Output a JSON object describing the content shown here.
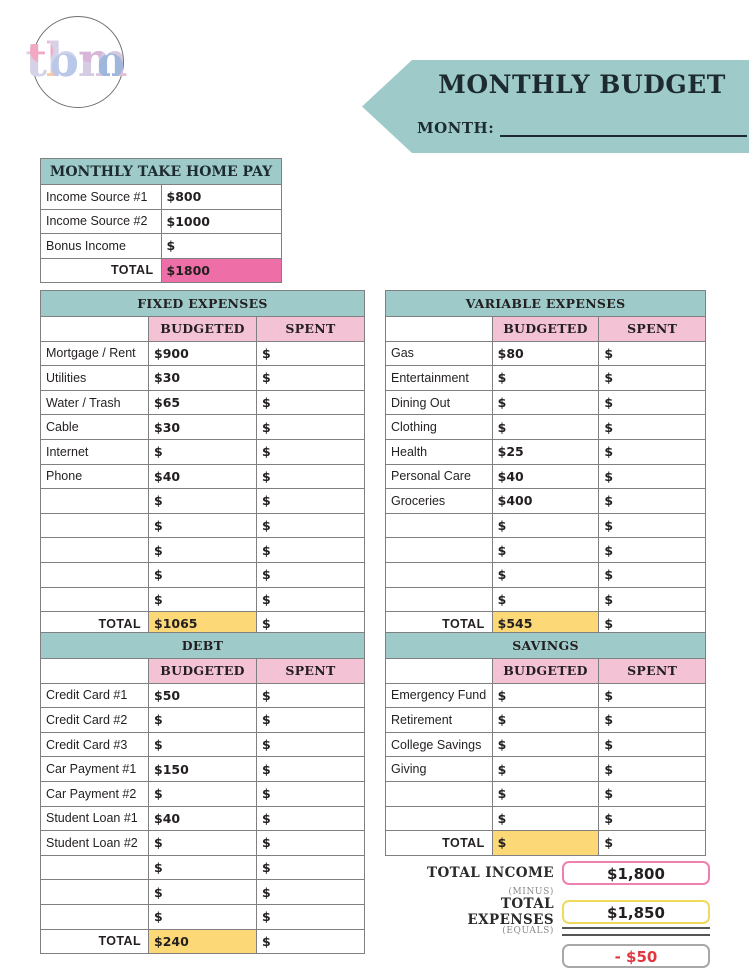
{
  "logo": {
    "text": "tbm"
  },
  "banner": {
    "title": "MONTHLY BUDGET",
    "month_label": "MONTH:",
    "month_value": "",
    "color": "#9ecbc9"
  },
  "colors": {
    "header_teal": "#9ecbc9",
    "column_pink": "#f3c2d4",
    "total_yellow": "#fcd976",
    "income_total_pink": "#ee6fa8",
    "negative_red": "#e0383e"
  },
  "income": {
    "title": "MONTHLY TAKE HOME PAY",
    "rows": [
      {
        "label": "Income Source #1",
        "value": "$800"
      },
      {
        "label": "Income Source #2",
        "value": "$1000"
      },
      {
        "label": "Bonus Income",
        "value": "$"
      }
    ],
    "total_label": "TOTAL",
    "total_value": "$1800"
  },
  "columns": {
    "budgeted": "BUDGETED",
    "spent": "SPENT"
  },
  "total_label": "TOTAL",
  "blank_money": "$",
  "sections": [
    {
      "title": "FIXED EXPENSES",
      "rows": [
        {
          "label": "Mortgage / Rent",
          "budgeted": "$900",
          "spent": "$"
        },
        {
          "label": "Utilities",
          "budgeted": "$30",
          "spent": "$"
        },
        {
          "label": "Water / Trash",
          "budgeted": "$65",
          "spent": "$"
        },
        {
          "label": "Cable",
          "budgeted": "$30",
          "spent": "$"
        },
        {
          "label": "Internet",
          "budgeted": "$",
          "spent": "$"
        },
        {
          "label": "Phone",
          "budgeted": "$40",
          "spent": "$"
        },
        {
          "label": "",
          "budgeted": "$",
          "spent": "$"
        },
        {
          "label": "",
          "budgeted": "$",
          "spent": "$"
        },
        {
          "label": "",
          "budgeted": "$",
          "spent": "$"
        },
        {
          "label": "",
          "budgeted": "$",
          "spent": "$"
        },
        {
          "label": "",
          "budgeted": "$",
          "spent": "$"
        }
      ],
      "total_budgeted": "$1065",
      "total_spent": "$"
    },
    {
      "title": "VARIABLE EXPENSES",
      "rows": [
        {
          "label": "Gas",
          "budgeted": "$80",
          "spent": "$"
        },
        {
          "label": "Entertainment",
          "budgeted": "$",
          "spent": "$"
        },
        {
          "label": "Dining Out",
          "budgeted": "$",
          "spent": "$"
        },
        {
          "label": "Clothing",
          "budgeted": "$",
          "spent": "$"
        },
        {
          "label": "Health",
          "budgeted": "$25",
          "spent": "$"
        },
        {
          "label": "Personal Care",
          "budgeted": "$40",
          "spent": "$"
        },
        {
          "label": "Groceries",
          "budgeted": "$400",
          "spent": "$"
        },
        {
          "label": "",
          "budgeted": "$",
          "spent": "$"
        },
        {
          "label": "",
          "budgeted": "$",
          "spent": "$"
        },
        {
          "label": "",
          "budgeted": "$",
          "spent": "$"
        },
        {
          "label": "",
          "budgeted": "$",
          "spent": "$"
        }
      ],
      "total_budgeted": "$545",
      "total_spent": "$"
    },
    {
      "title": "DEBT",
      "rows": [
        {
          "label": "Credit Card #1",
          "budgeted": "$50",
          "spent": "$"
        },
        {
          "label": "Credit Card #2",
          "budgeted": "$",
          "spent": "$"
        },
        {
          "label": "Credit Card #3",
          "budgeted": "$",
          "spent": "$"
        },
        {
          "label": "Car Payment #1",
          "budgeted": "$150",
          "spent": "$"
        },
        {
          "label": "Car Payment #2",
          "budgeted": "$",
          "spent": "$"
        },
        {
          "label": "Student Loan #1",
          "budgeted": "$40",
          "spent": "$"
        },
        {
          "label": "Student Loan #2",
          "budgeted": "$",
          "spent": "$"
        },
        {
          "label": "",
          "budgeted": "$",
          "spent": "$"
        },
        {
          "label": "",
          "budgeted": "$",
          "spent": "$"
        },
        {
          "label": "",
          "budgeted": "$",
          "spent": "$"
        }
      ],
      "total_budgeted": "$240",
      "total_spent": "$"
    },
    {
      "title": "SAVINGS",
      "rows": [
        {
          "label": "Emergency Fund",
          "budgeted": "$",
          "spent": "$"
        },
        {
          "label": "Retirement",
          "budgeted": "$",
          "spent": "$"
        },
        {
          "label": "College Savings",
          "budgeted": "$",
          "spent": "$"
        },
        {
          "label": "Giving",
          "budgeted": "$",
          "spent": "$"
        },
        {
          "label": "",
          "budgeted": "$",
          "spent": "$"
        },
        {
          "label": "",
          "budgeted": "$",
          "spent": "$"
        }
      ],
      "total_budgeted": "$",
      "total_spent": "$"
    }
  ],
  "summary": {
    "income_label": "TOTAL INCOME",
    "income_value": "$1,800",
    "minus_label": "(MINUS)",
    "expenses_label": "TOTAL EXPENSES",
    "expenses_value": "$1,850",
    "equals_label": "(EQUALS)",
    "result_value": "- $50"
  }
}
